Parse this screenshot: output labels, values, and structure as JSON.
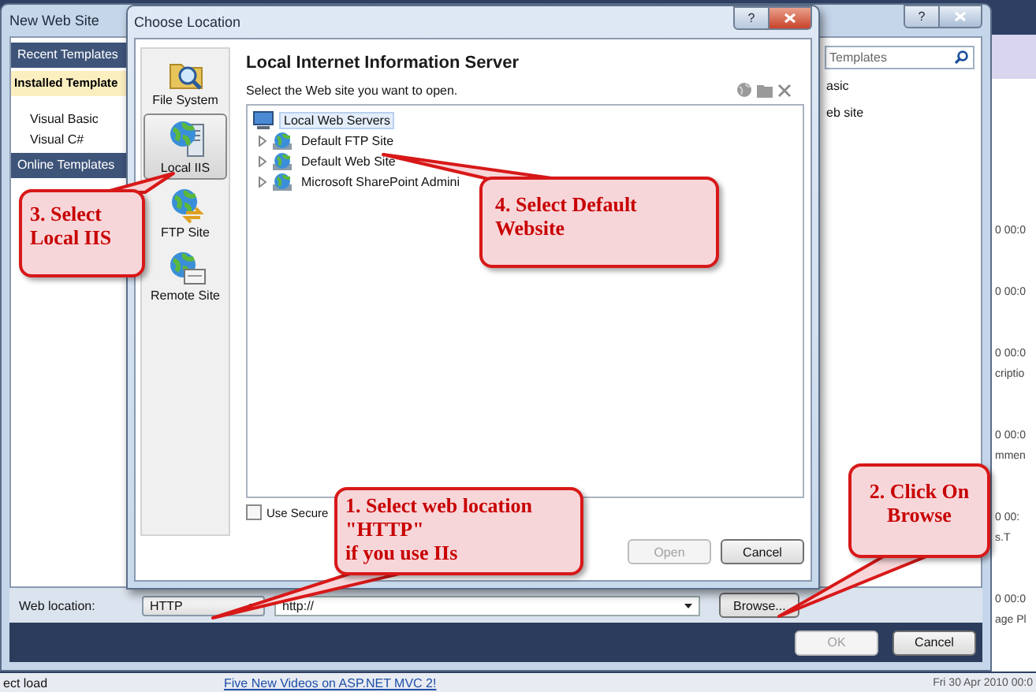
{
  "background_window": {
    "entries": [
      {
        "date": "0 00:0"
      },
      {
        "date": "0 00:0"
      },
      {
        "date": "0 00:0",
        "title": "criptio"
      },
      {
        "date": "0 00:0",
        "title": "mmen"
      },
      {
        "date": "0 00:",
        "title": "s.T"
      },
      {
        "date": "0 00:0",
        "title": "age Pl"
      }
    ],
    "last_date": "Fri 30 Apr 2010 00:0",
    "status_text": "ect load",
    "news_link": "Five New Videos on ASP.NET MVC 2!"
  },
  "new_web_site_dialog": {
    "title": "New Web Site",
    "help": "?",
    "sidebar": [
      {
        "label": "Recent Templates",
        "kind": "header",
        "selected": false
      },
      {
        "label": "Installed Template",
        "kind": "header",
        "selected": true
      },
      {
        "label": "Visual Basic",
        "kind": "item",
        "selected": false
      },
      {
        "label": "Visual C#",
        "kind": "item",
        "selected": false
      },
      {
        "label": "Online Templates",
        "kind": "header",
        "selected": false
      }
    ],
    "search": {
      "placeholder": "Templates"
    },
    "templates": [
      "asic",
      "eb site"
    ],
    "web_location": {
      "label": "Web location:",
      "type": "HTTP",
      "url": "http://",
      "browse": "Browse..."
    },
    "buttons": [
      {
        "label": "OK",
        "disabled": true
      },
      {
        "label": "Cancel",
        "disabled": false
      }
    ]
  },
  "choose_location_dialog": {
    "title": "Choose Location",
    "help": "?",
    "locations": [
      {
        "label": "File System",
        "kind": "folder",
        "selected": false
      },
      {
        "label": "Local IIS",
        "kind": "iis",
        "selected": true
      },
      {
        "label": "FTP Site",
        "kind": "ftp",
        "selected": false
      },
      {
        "label": "Remote Site",
        "kind": "remote",
        "selected": false
      }
    ],
    "heading": "Local Internet Information Server",
    "instruction": "Select the Web site you want to open.",
    "tree": [
      {
        "label": "Local Web Servers",
        "kind": "computer",
        "selected": true,
        "children": [
          {
            "label": "Default FTP Site",
            "kind": "site",
            "selected": false,
            "expanded": false
          },
          {
            "label": "Default Web Site",
            "kind": "site",
            "selected": false,
            "expanded": false
          },
          {
            "label": "Microsoft SharePoint Admini",
            "kind": "site",
            "selected": false,
            "expanded": false
          }
        ]
      }
    ],
    "secure_checkbox": {
      "label": "Use Secure",
      "checked": false
    },
    "buttons": [
      {
        "label": "Open",
        "disabled": true
      },
      {
        "label": "Cancel",
        "disabled": false
      }
    ]
  },
  "callouts": [
    {
      "text": "1. Select web location\n\"HTTP\"\nif you use IIs"
    },
    {
      "text": "2. Click On\nBrowse"
    },
    {
      "text": "3. Select\nLocal IIS"
    },
    {
      "text": "4. Select Default\nWebsite"
    }
  ]
}
